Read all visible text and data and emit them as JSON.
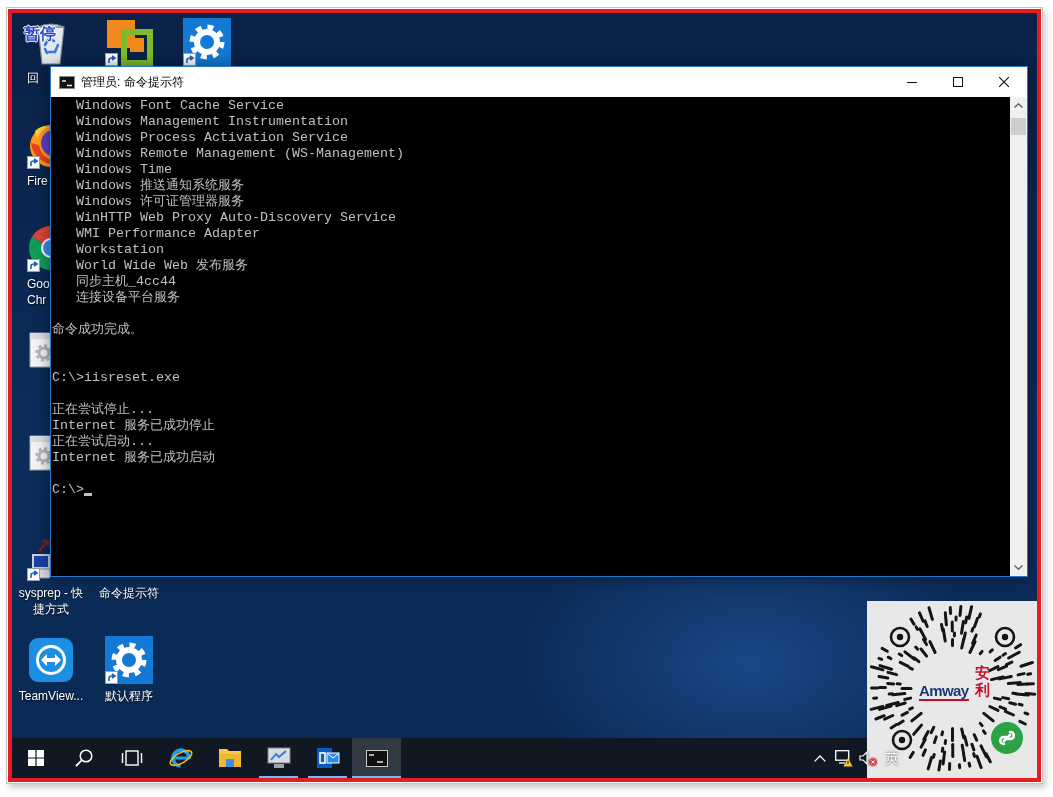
{
  "overlay_text": "暂停",
  "desktop_icons": [
    {
      "kind": "recycle",
      "shortcut": false,
      "label": {
        "text": "回",
        "cut_off": true
      }
    },
    {
      "kind": "fox",
      "shortcut": true,
      "label": {
        "text": "Fire",
        "cut_off": true
      }
    },
    {
      "kind": "ring",
      "shortcut": true,
      "label": {
        "text": "Goo Chr",
        "cut_off": true
      }
    },
    {
      "kind": "dialog",
      "shortcut": false
    },
    {
      "kind": "dialog",
      "shortcut": false
    },
    {
      "kind": "computer",
      "shortcut": true,
      "label": {
        "text": "sysprep - 快捷方式",
        "cut_off": false
      }
    },
    {
      "kind": "remote",
      "shortcut": false,
      "label": {
        "text": "TeamView...",
        "cut_off": false
      }
    },
    {
      "kind": "squares",
      "shortcut": true
    },
    {
      "label": {
        "text": "命令提示符",
        "cut_off": false
      }
    },
    {
      "kind": "gear",
      "shortcut": true,
      "label": {
        "text": "默认程序",
        "cut_off": false
      }
    },
    {
      "kind": "gear",
      "shortcut": true
    }
  ],
  "window": {
    "title": "管理员: 命令提示符",
    "cursor": true,
    "lines": [
      {
        "kind": "text",
        "text": "Windows Font Cache Service",
        "indented": true
      },
      {
        "kind": "text",
        "text": "Windows Management Instrumentation",
        "indented": true
      },
      {
        "kind": "text",
        "text": "Windows Process Activation Service",
        "indented": true
      },
      {
        "kind": "text",
        "text": "Windows Remote Management (WS-Management)",
        "indented": true
      },
      {
        "kind": "text",
        "text": "Windows Time",
        "indented": true
      },
      {
        "kind": "text",
        "text": "Windows 推送通知系统服务",
        "indented": true
      },
      {
        "kind": "text",
        "text": "Windows 许可证管理器服务",
        "indented": true
      },
      {
        "kind": "text",
        "text": "WinHTTP Web Proxy Auto-Discovery Service",
        "indented": true
      },
      {
        "kind": "text",
        "text": "WMI Performance Adapter",
        "indented": true
      },
      {
        "kind": "text",
        "text": "Workstation",
        "indented": true
      },
      {
        "kind": "text",
        "text": "World Wide Web 发布服务",
        "indented": true
      },
      {
        "kind": "text",
        "text": "同步主机_4cc44",
        "indented": true
      },
      {
        "kind": "text",
        "text": "连接设备平台服务",
        "indented": true
      },
      {
        "kind": "blank"
      },
      {
        "kind": "text",
        "text": "命令成功完成。",
        "indented": false
      },
      {
        "kind": "blank"
      },
      {
        "kind": "blank"
      },
      {
        "kind": "text",
        "text": "C:\\>iisreset.exe",
        "indented": false
      },
      {
        "kind": "blank"
      },
      {
        "kind": "text",
        "text": "正在尝试停止...",
        "indented": false
      },
      {
        "kind": "text",
        "text": "Internet 服务已成功停止",
        "indented": false
      },
      {
        "kind": "text",
        "text": "正在尝试启动...",
        "indented": false
      },
      {
        "kind": "text",
        "text": "Internet 服务已成功启动",
        "indented": false
      },
      {
        "kind": "blank"
      },
      {
        "kind": "text",
        "text": "C:\\>",
        "indented": false
      }
    ]
  },
  "taskbar": {
    "buttons": [
      {
        "kind": "start"
      },
      {
        "kind": "search"
      },
      {
        "kind": "task_view"
      }
    ],
    "apps": [
      {
        "kind": "e_logo",
        "running": false,
        "selected": false
      },
      {
        "kind": "folder",
        "running": false,
        "selected": false
      },
      {
        "kind": "monitor",
        "running": true,
        "selected": false
      },
      {
        "kind": "mail",
        "running": true,
        "selected": false
      },
      {
        "kind": "console",
        "running": true,
        "selected": true
      }
    ],
    "tray": {
      "network_warning": true,
      "muted": true,
      "language": "英"
    }
  },
  "qr_overlay": {
    "logo": "Amway",
    "logo_mark": "安利"
  }
}
